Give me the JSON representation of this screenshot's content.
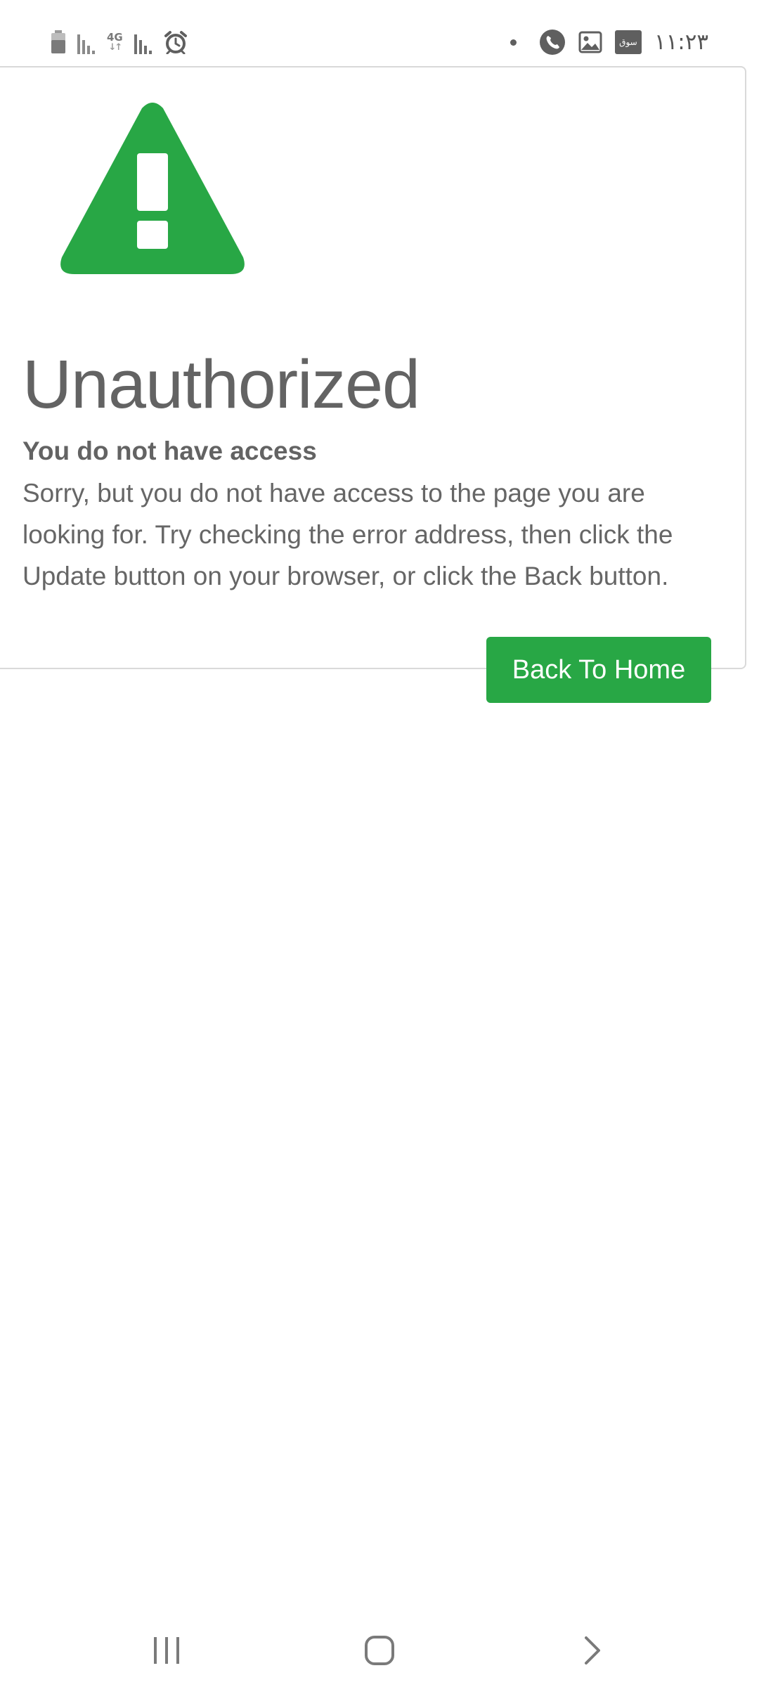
{
  "status_bar": {
    "time": "١١:٢٣",
    "network_type": "4G",
    "network_arrows": "↓↑",
    "app_badge_text": "سوق",
    "icons": [
      "battery-icon",
      "signal-icon",
      "network-4g-icon",
      "signal-icon",
      "alarm-icon",
      "notification-dot-icon",
      "phone-icon",
      "gallery-icon",
      "app-notification-icon"
    ]
  },
  "error_page": {
    "icon": "warning-triangle-icon",
    "title": "Unauthorized",
    "subtitle": "You do not have access",
    "message": "Sorry, but you do not have access to the page you are looking for. Try checking the error address, then click the Update button on your browser, or click the Back button.",
    "button_label": "Back To Home"
  },
  "nav_bar": {
    "items": [
      "recent-apps-icon",
      "home-icon",
      "back-icon"
    ]
  },
  "colors": {
    "accent": "#28a745",
    "text": "#636363",
    "card_border": "#d9d9d9",
    "system_icons": "#5f5f5f"
  }
}
